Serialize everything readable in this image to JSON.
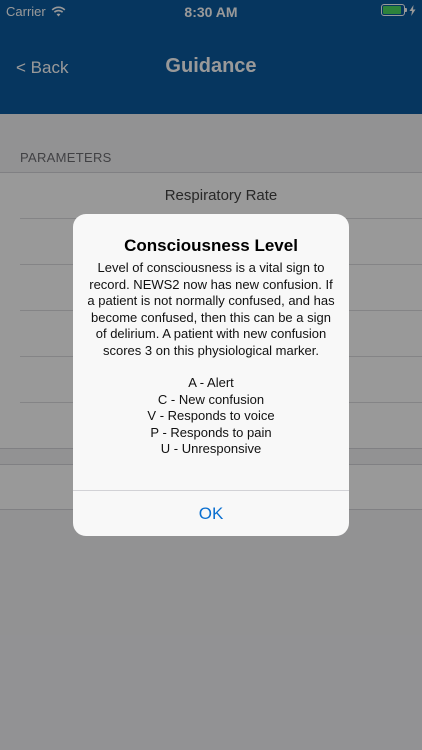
{
  "status_bar": {
    "carrier": "Carrier",
    "time": "8:30 AM",
    "icons": [
      "wifi-icon",
      "battery-icon",
      "charging-bolt-icon"
    ]
  },
  "nav": {
    "back_label": "< Back",
    "title": "Guidance"
  },
  "content": {
    "section_header": "PARAMETERS",
    "parameters": [
      "Respiratory Rate",
      "",
      "",
      "",
      "",
      ""
    ]
  },
  "dialog": {
    "title": "Consciousness Level",
    "message": "Level of consciousness is a vital sign to record. NEWS2 now has new confusion. If a patient is not normally confused, and has become confused, then this can be a sign of delirium. A patient with new confusion scores 3 on this physiological marker.",
    "levels": [
      "A - Alert",
      "C - New confusion",
      "V - Responds to voice",
      "P - Responds to pain",
      "U - Unresponsive"
    ],
    "ok_label": "OK"
  },
  "colors": {
    "nav_background": "#0a5a9e",
    "ok_text": "#0a6fd0",
    "battery_fill": "#4cd964"
  }
}
